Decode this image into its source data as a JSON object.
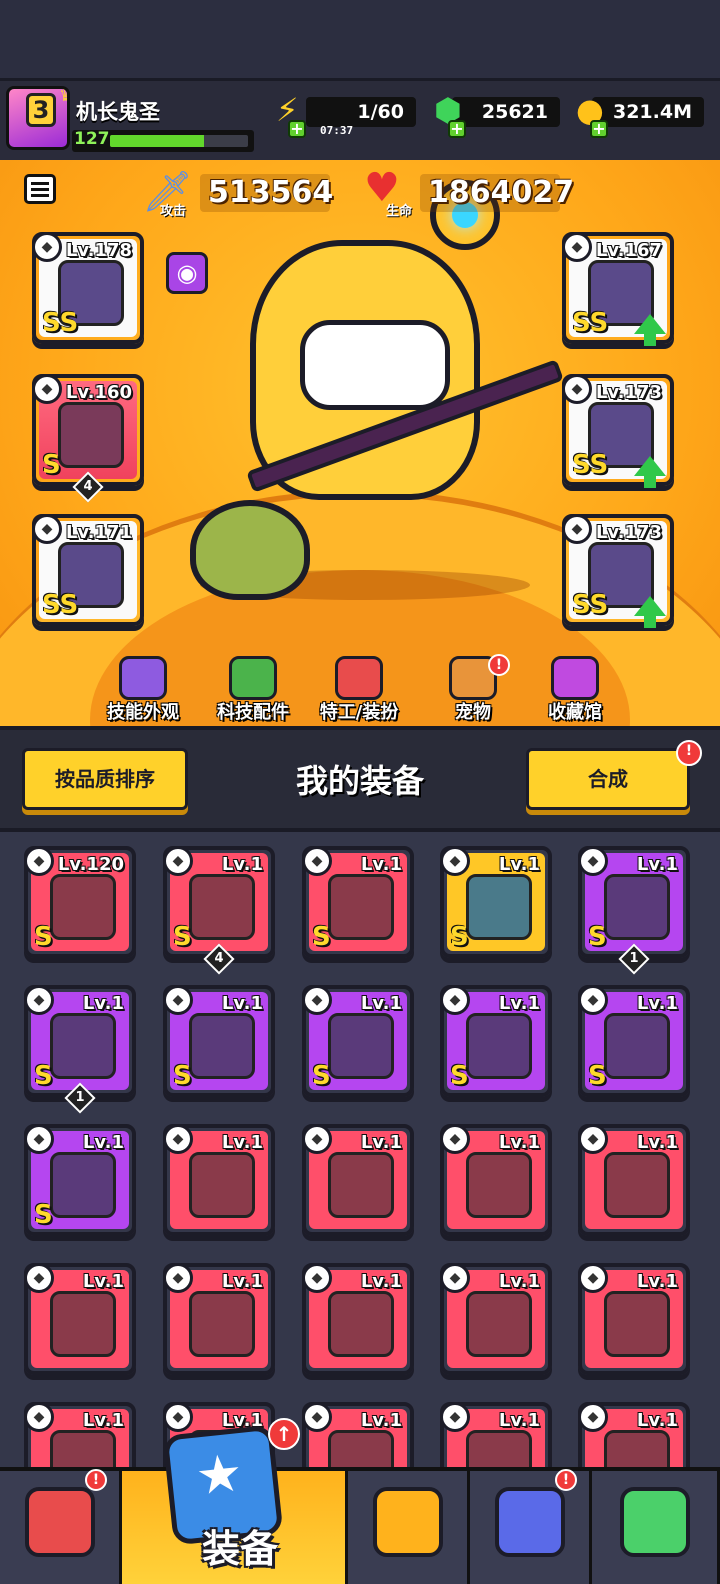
{
  "player": {
    "name": "机长鬼圣",
    "rank_badge": "3",
    "level": "127",
    "xp_progress_pct": 68
  },
  "resources": {
    "energy": "1/60",
    "energy_timer": "07:37",
    "gems": "25621",
    "gold": "321.4M"
  },
  "stats": {
    "attack_value": "513564",
    "attack_label": "攻击",
    "hp_value": "1864027",
    "hp_label": "生命"
  },
  "equipped": [
    {
      "slot": "weapon",
      "level": "Lv.178",
      "grade": "SS",
      "quality": "white",
      "icon": "staff-icon"
    },
    {
      "slot": "necklace",
      "level": "Lv.160",
      "grade": "S",
      "quality": "red",
      "stars": "4",
      "icon": "necklace-icon"
    },
    {
      "slot": "gloves",
      "level": "Lv.171",
      "grade": "SS",
      "quality": "white",
      "icon": "gauntlet-icon"
    },
    {
      "slot": "armor",
      "level": "Lv.167",
      "grade": "SS",
      "quality": "white",
      "upgrade": true,
      "icon": "armor-icon"
    },
    {
      "slot": "belt",
      "level": "Lv.173",
      "grade": "SS",
      "quality": "white",
      "upgrade": true,
      "icon": "belt-icon"
    },
    {
      "slot": "boots",
      "level": "Lv.173",
      "grade": "SS",
      "quality": "white",
      "upgrade": true,
      "icon": "boots-icon"
    }
  ],
  "nav": [
    {
      "label": "技能外观",
      "icon": "skill-skin-icon",
      "color": "#8e5be0"
    },
    {
      "label": "科技配件",
      "icon": "tech-parts-icon",
      "color": "#4bb34b"
    },
    {
      "label": "特工/装扮",
      "icon": "agent-icon",
      "color": "#e84c4c"
    },
    {
      "label": "宠物",
      "icon": "pet-icon",
      "color": "#e8943a",
      "badge": "!"
    },
    {
      "label": "收藏馆",
      "icon": "collection-icon",
      "color": "#c04ae0"
    }
  ],
  "inventory_bar": {
    "sort_label": "按品质排序",
    "title": "我的装备",
    "merge_label": "合成",
    "merge_badge": "!"
  },
  "inventory": [
    {
      "level": "Lv.120",
      "grade": "S",
      "quality": "red",
      "type": "armor-icon"
    },
    {
      "level": "Lv.1",
      "grade": "S",
      "quality": "red",
      "type": "gauntlet-icon",
      "stars": "4"
    },
    {
      "level": "Lv.1",
      "grade": "S",
      "quality": "red",
      "type": "armor-icon"
    },
    {
      "level": "Lv.1",
      "grade": "S",
      "quality": "yellow",
      "type": "gauntlet-icon"
    },
    {
      "level": "Lv.1",
      "grade": "S",
      "quality": "purple",
      "type": "boots-icon",
      "stars": "1"
    },
    {
      "level": "Lv.1",
      "grade": "S",
      "quality": "purple",
      "type": "boots-icon",
      "stars": "1"
    },
    {
      "level": "Lv.1",
      "grade": "S",
      "quality": "purple",
      "type": "armor-icon"
    },
    {
      "level": "Lv.1",
      "grade": "S",
      "quality": "purple",
      "type": "necklace-icon"
    },
    {
      "level": "Lv.1",
      "grade": "S",
      "quality": "purple",
      "type": "gauntlet-icon"
    },
    {
      "level": "Lv.1",
      "grade": "S",
      "quality": "purple",
      "type": "gauntlet-icon"
    },
    {
      "level": "Lv.1",
      "grade": "S",
      "quality": "purple",
      "type": "gauntlet-icon"
    },
    {
      "level": "Lv.1",
      "grade": "",
      "quality": "red",
      "type": "kunai-icon"
    },
    {
      "level": "Lv.1",
      "grade": "",
      "quality": "red",
      "type": "kunai-icon"
    },
    {
      "level": "Lv.1",
      "grade": "",
      "quality": "red",
      "type": "kunai-icon"
    },
    {
      "level": "Lv.1",
      "grade": "",
      "quality": "red",
      "type": "sword-icon"
    },
    {
      "level": "Lv.1",
      "grade": "",
      "quality": "red",
      "type": "sword-icon"
    },
    {
      "level": "Lv.1",
      "grade": "",
      "quality": "red",
      "type": "sword-icon"
    },
    {
      "level": "Lv.1",
      "grade": "",
      "quality": "red",
      "type": "revolver-icon"
    },
    {
      "level": "Lv.1",
      "grade": "",
      "quality": "red",
      "type": "revolver-icon"
    },
    {
      "level": "Lv.1",
      "grade": "",
      "quality": "red",
      "type": "revolver-icon"
    },
    {
      "level": "Lv.1",
      "grade": "",
      "quality": "red",
      "type": "gun-icon"
    },
    {
      "level": "Lv.1",
      "grade": "",
      "quality": "red",
      "type": "gun-icon"
    },
    {
      "level": "Lv.1",
      "grade": "",
      "quality": "red",
      "type": "gun-icon"
    },
    {
      "level": "Lv.1",
      "grade": "",
      "quality": "red",
      "type": "bomb-icon"
    },
    {
      "level": "Lv.1",
      "grade": "",
      "quality": "red",
      "type": "bomb-icon"
    }
  ],
  "bottom_tabs": [
    {
      "icon": "shop-icon",
      "badge": "!"
    },
    {
      "label": "装备",
      "icon": "equipment-icon",
      "active": true,
      "badge": "↑"
    },
    {
      "icon": "battle-icon"
    },
    {
      "icon": "planet-icon",
      "badge": "!"
    },
    {
      "icon": "dna-icon"
    }
  ],
  "colors": {
    "red": "#ff4f6a",
    "purple": "#b546f0",
    "yellow": "#ffc726",
    "accent": "#ffd12a"
  }
}
